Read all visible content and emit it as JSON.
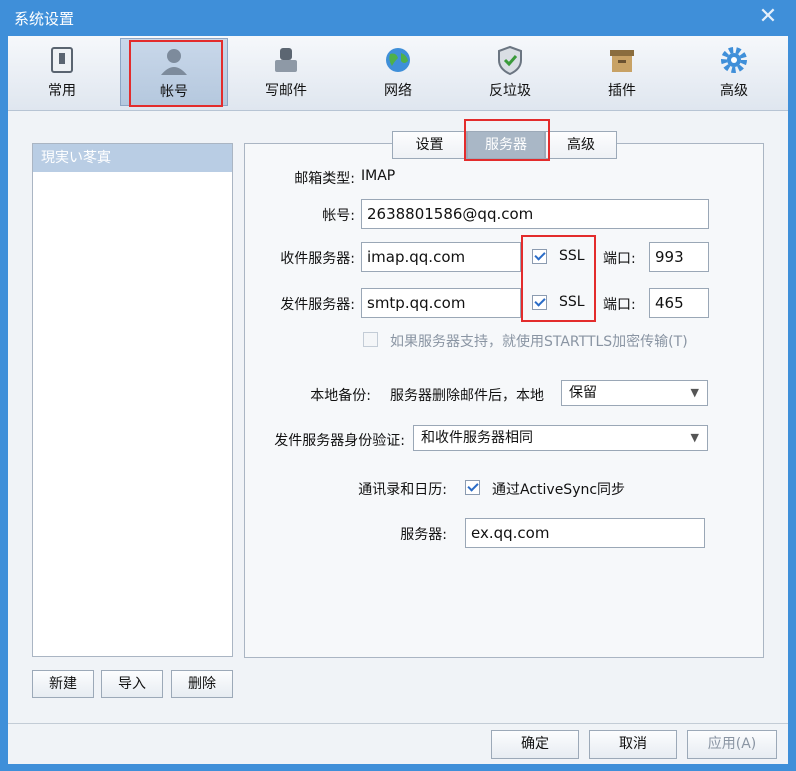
{
  "window": {
    "title": "系统设置",
    "close_label": "✕"
  },
  "toolbar": {
    "items": [
      {
        "label": "常用",
        "icon": "switch-icon"
      },
      {
        "label": "帐号",
        "icon": "user-icon"
      },
      {
        "label": "写邮件",
        "icon": "pen-icon"
      },
      {
        "label": "网络",
        "icon": "globe-icon"
      },
      {
        "label": "反垃圾",
        "icon": "shield-icon"
      },
      {
        "label": "插件",
        "icon": "box-icon"
      },
      {
        "label": "高级",
        "icon": "gear-icon"
      }
    ],
    "active_index": 1
  },
  "accounts": {
    "selected": "現実い苳寘",
    "buttons": {
      "new": "新建",
      "import": "导入",
      "delete": "删除"
    }
  },
  "tabs": {
    "settings": "设置",
    "server": "服务器",
    "advanced": "高级",
    "active": "服务器"
  },
  "server": {
    "mail_type_label": "邮箱类型:",
    "mail_type_value": "IMAP",
    "account_label": "帐号:",
    "account_value": "2638801586@qq.com",
    "incoming_label": "收件服务器:",
    "incoming_value": "imap.qq.com",
    "incoming_ssl_label": "SSL",
    "incoming_ssl_checked": true,
    "incoming_port_label": "端口:",
    "incoming_port_value": "993",
    "outgoing_label": "发件服务器:",
    "outgoing_value": "smtp.qq.com",
    "outgoing_ssl_label": "SSL",
    "outgoing_ssl_checked": true,
    "outgoing_port_label": "端口:",
    "outgoing_port_value": "465",
    "starttls_label": "如果服务器支持，就使用STARTTLS加密传输(T)",
    "starttls_checked": false,
    "backup_label": "本地备份:",
    "backup_desc": "服务器删除邮件后，本地",
    "backup_value": "保留",
    "auth_label": "发件服务器身份验证:",
    "auth_value": "和收件服务器相同",
    "contacts_label": "通讯录和日历:",
    "activesync_label": "通过ActiveSync同步",
    "activesync_checked": true,
    "exchange_label": "服务器:",
    "exchange_value": "ex.qq.com"
  },
  "footer": {
    "ok": "确定",
    "cancel": "取消",
    "apply": "应用(A)"
  },
  "colors": {
    "titlebar": "#3f8fd9",
    "highlight_box": "#e32c2c",
    "checkbox_mark": "#2a6cc7"
  }
}
